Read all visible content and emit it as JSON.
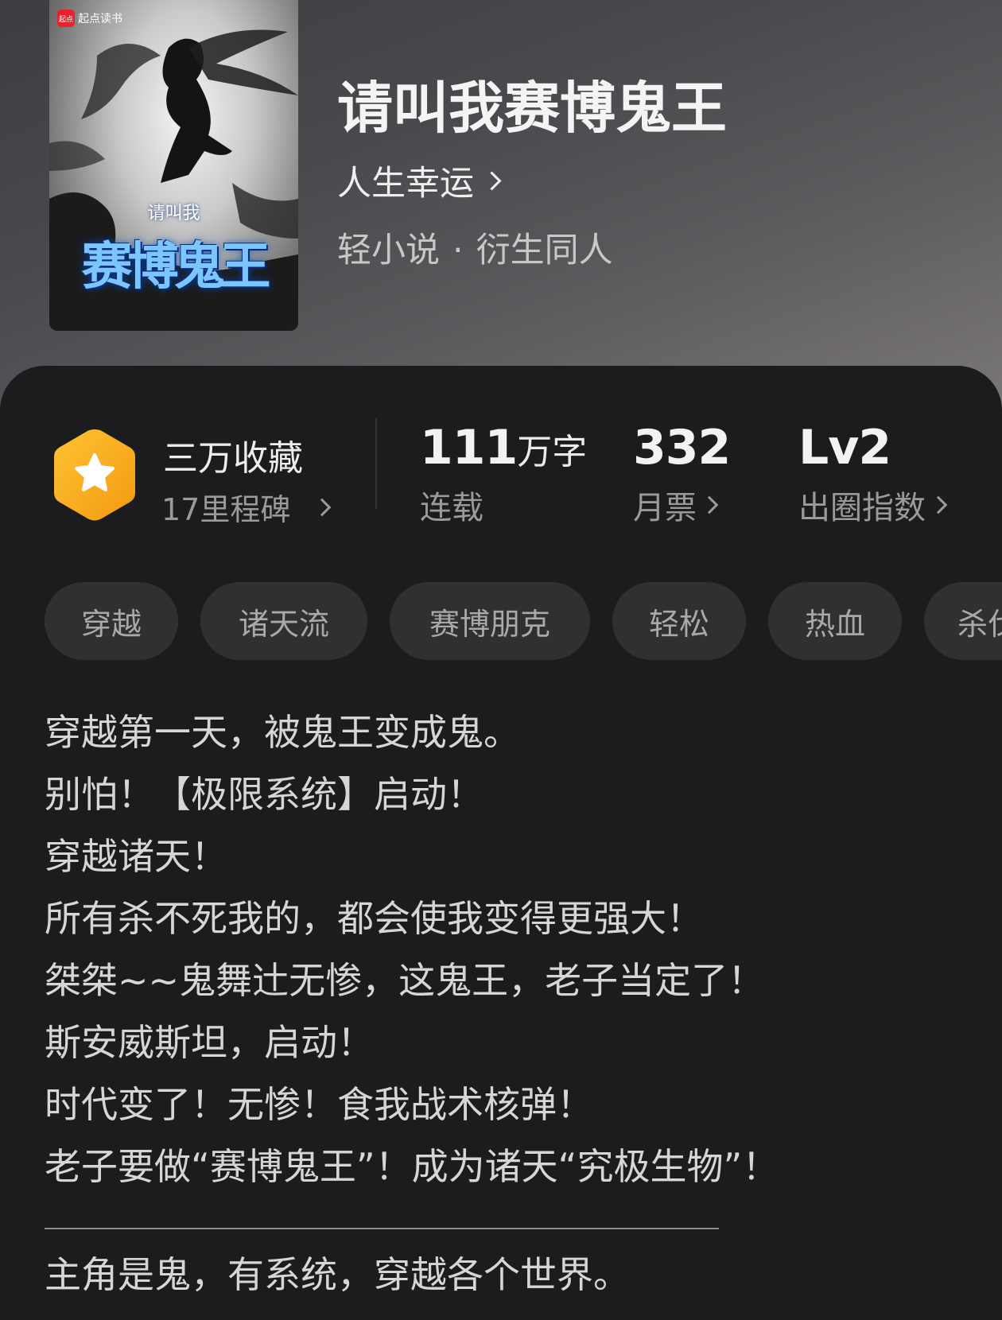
{
  "book": {
    "cover": {
      "badge": "起点读书",
      "badge_icon": "起点",
      "subtitle": "请叫我",
      "title": "赛博鬼王"
    },
    "title": "请叫我赛博鬼王",
    "author": "人生幸运",
    "category": "轻小说",
    "separator": "·",
    "subcategory": "衍生同人"
  },
  "stats": {
    "favorites": {
      "icon": "star-hexagon-icon",
      "label": "三万收藏",
      "milestones": "17里程碑"
    },
    "word_count": {
      "value": "111",
      "unit": "万字",
      "status": "连载"
    },
    "monthly_tickets": {
      "value": "332",
      "label": "月票"
    },
    "breakout_index": {
      "value": "Lv2",
      "label": "出圈指数"
    }
  },
  "tags": [
    "穿越",
    "诸天流",
    "赛博朋克",
    "轻松",
    "热血",
    "杀伐"
  ],
  "description": {
    "lines": [
      "穿越第一天，被鬼王变成鬼。",
      "别怕！【极限系统】启动！",
      "穿越诸天！",
      "所有杀不死我的，都会使我变得更强大！",
      "桀桀~~鬼舞辻无惨，这鬼王，老子当定了！",
      "斯安威斯坦，启动！",
      "时代变了！无惨！食我战术核弹！",
      "老子要做“赛博鬼王”！成为诸天“究极生物”！"
    ],
    "summary": "主角是鬼，有系统，穿越各个世界。"
  },
  "colors": {
    "background": "#1c1c1e",
    "tag_background": "#303032",
    "badge_orange": "#f7a41c",
    "text_primary": "#f2f2f2",
    "text_secondary": "#9a9a9c"
  }
}
